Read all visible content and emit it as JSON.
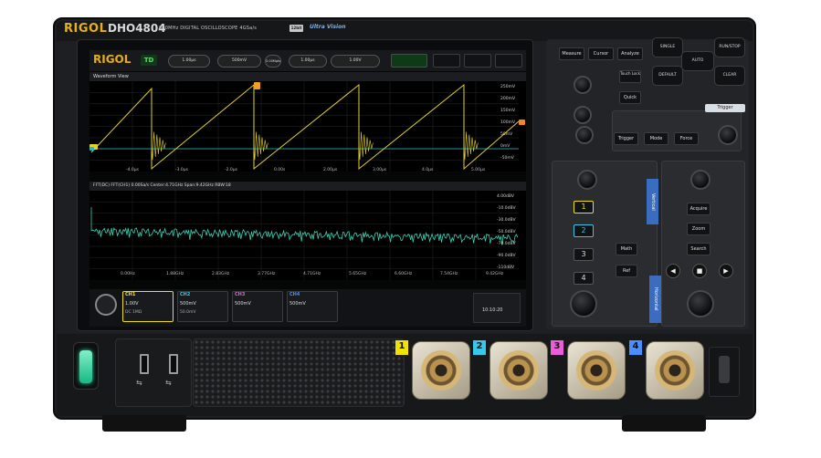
{
  "device": {
    "brand": "RIGOL",
    "model": "DHO4804",
    "description": "800MHz DIGITAL OSCILLOSCOPE 4GSa/s",
    "badge": "12bit",
    "series": "Ultra Vision"
  },
  "screen": {
    "logo": "RIGOL",
    "mode": "TD",
    "status": [
      "1.00μs",
      "500mV",
      "5.00Mpts",
      "1.00μs",
      "1.00V"
    ],
    "waveform_title": "Waveform View",
    "y_labels": [
      "250mV",
      "200mV",
      "150mV",
      "100mV",
      "50mV",
      "0mV",
      "-50mV"
    ],
    "time_labels": [
      "-4.0μs",
      "-3.0μs",
      "-2.0μs",
      "0.00s",
      "2.00μs",
      "3.00μs",
      "4.0μs",
      "5.00μs"
    ],
    "fft_info": "FFT(DC)  FFT(CH1)  0.00Sa/s  Center:4.71GHz  Span:9.42GHz  RBW:18",
    "fft_y_labels": [
      "4.00dBV",
      "-10.0dBV",
      "-30.0dBV",
      "-50.0dBV",
      "-70.0dBV",
      "-90.0dBV",
      "-110dBV"
    ],
    "fft_x_labels": [
      "0.00Hz",
      "1.88GHz",
      "2.83GHz",
      "3.77GHz",
      "4.71GHz",
      "5.65GHz",
      "6.60GHz",
      "7.54GHz",
      "9.42GHz"
    ],
    "channels": [
      {
        "name": "CH1",
        "line1": "1.00V",
        "line2": "DC 1MΩ"
      },
      {
        "name": "CH2",
        "line1": "500mV",
        "line2": "50.0mV"
      },
      {
        "name": "CH3",
        "line1": "500mV",
        "line2": ""
      },
      {
        "name": "CH4",
        "line1": "500mV",
        "line2": ""
      }
    ],
    "clock": "10:10:20"
  },
  "panel": {
    "keys": [
      "Measure",
      "Cursor",
      "Analyze"
    ],
    "nav": [
      "SINGLE",
      "RUN/STOP",
      "AUTO",
      "DEFAULT",
      "CLEAR"
    ],
    "touch": "Touch Lock",
    "quick": "Quick",
    "trigger_title": "Trigger",
    "trigger_keys": [
      "Trigger",
      "Mode",
      "Force"
    ],
    "vertical": "Vertical",
    "horizontal": "Horizontal",
    "ch_keys": [
      "1",
      "2",
      "3",
      "4"
    ],
    "math": "Math",
    "ref": "Ref",
    "h_keys": [
      "Acquire",
      "Zoom",
      "Search"
    ]
  },
  "front": {
    "channel_tags": [
      "1",
      "2",
      "3",
      "4"
    ],
    "channel_colors": [
      "#f2e200",
      "#3ac8e8",
      "#ea5fd7",
      "#4a8fff"
    ],
    "usb_symbol": "⇆"
  },
  "chart_data": {
    "type": "line",
    "series": [
      {
        "name": "CH1",
        "color": "#e8d82a"
      },
      {
        "name": "CH2",
        "color": "#38d0c8"
      }
    ]
  }
}
